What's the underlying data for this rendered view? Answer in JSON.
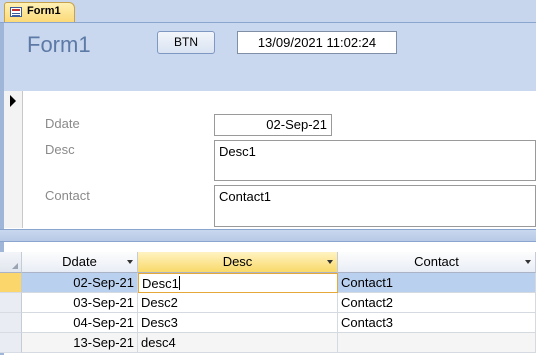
{
  "tab": {
    "label": "Form1"
  },
  "header": {
    "title": "Form1",
    "button_label": "BTN",
    "datetime_value": "13/09/2021 11:02:24"
  },
  "detail": {
    "labels": {
      "ddate": "Ddate",
      "desc": "Desc",
      "contact": "Contact"
    },
    "values": {
      "ddate": "02-Sep-21",
      "desc": "Desc1",
      "contact": "Contact1"
    }
  },
  "datasheet": {
    "columns": [
      "Ddate",
      "Desc",
      "Contact"
    ],
    "rows": [
      {
        "ddate": "02-Sep-21",
        "desc": "Desc1",
        "contact": "Contact1"
      },
      {
        "ddate": "03-Sep-21",
        "desc": "Desc2",
        "contact": "Contact2"
      },
      {
        "ddate": "04-Sep-21",
        "desc": "Desc3",
        "contact": "Contact3"
      },
      {
        "ddate": "13-Sep-21",
        "desc": "desc4",
        "contact": ""
      }
    ]
  },
  "colors": {
    "header_bg": "#c9d8ee",
    "title": "#5d7aa6",
    "active_tab": "#fbd977",
    "selected_row": "#b9d0ef",
    "record_selector_active": "#fbd66a"
  }
}
